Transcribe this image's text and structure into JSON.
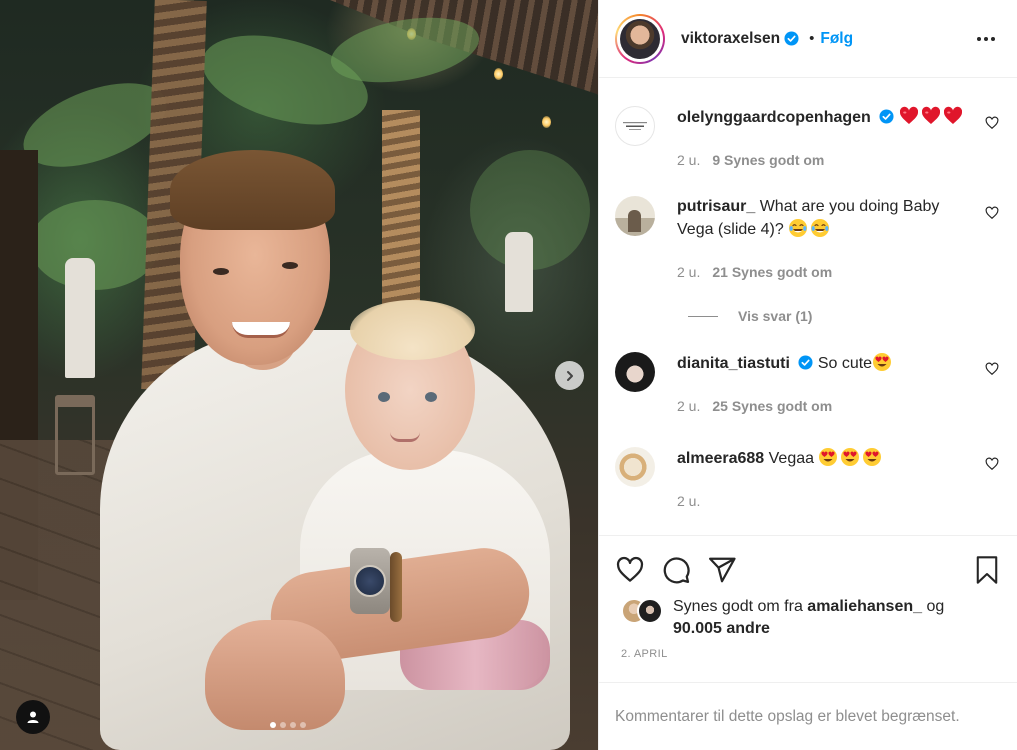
{
  "post": {
    "author": "viktoraxelsen",
    "separator": "•",
    "follow_label": "Følg",
    "date": "2. APRIL",
    "carousel": {
      "slide_count": 4,
      "active_slide": 1
    }
  },
  "comments": [
    {
      "user": "olelynggaardcopenhagen",
      "verified": true,
      "text": "",
      "emojis": [
        "red-heart",
        "red-heart",
        "red-heart"
      ],
      "time": "2 u.",
      "likes": "9 Synes godt om"
    },
    {
      "user": "putrisaur_",
      "verified": false,
      "text": "What are you doing Baby Vega (slide 4)?",
      "emojis": [
        "tears-of-joy",
        "tears-of-joy"
      ],
      "time": "2 u.",
      "likes": "21 Synes godt om",
      "replies": "Vis svar (1)"
    },
    {
      "user": "dianita_tiastuti",
      "verified": true,
      "text": "So cute",
      "emojis": [
        "heart-eyes"
      ],
      "time": "2 u.",
      "likes": "25 Synes godt om"
    },
    {
      "user": "almeera688",
      "verified": false,
      "text": "Vegaa",
      "emojis": [
        "heart-eyes",
        "heart-eyes",
        "heart-eyes"
      ],
      "time": "2 u.",
      "likes": ""
    }
  ],
  "likes_summary": {
    "prefix": "Synes godt om fra",
    "user": "amaliehansen_",
    "joiner": "og",
    "others": "90.005 andre"
  },
  "footer": {
    "text": "Kommentarer til dette opslag er blevet begrænset."
  },
  "colors": {
    "accent": "#0095f6",
    "text": "#262626",
    "muted": "#8e8e8e",
    "border": "#efefef",
    "heart": "#ed4956"
  },
  "icons": [
    "verified-icon",
    "more-options-icon",
    "heart-icon",
    "comment-icon",
    "share-icon",
    "bookmark-icon",
    "next-arrow-icon",
    "user-tag-icon"
  ]
}
